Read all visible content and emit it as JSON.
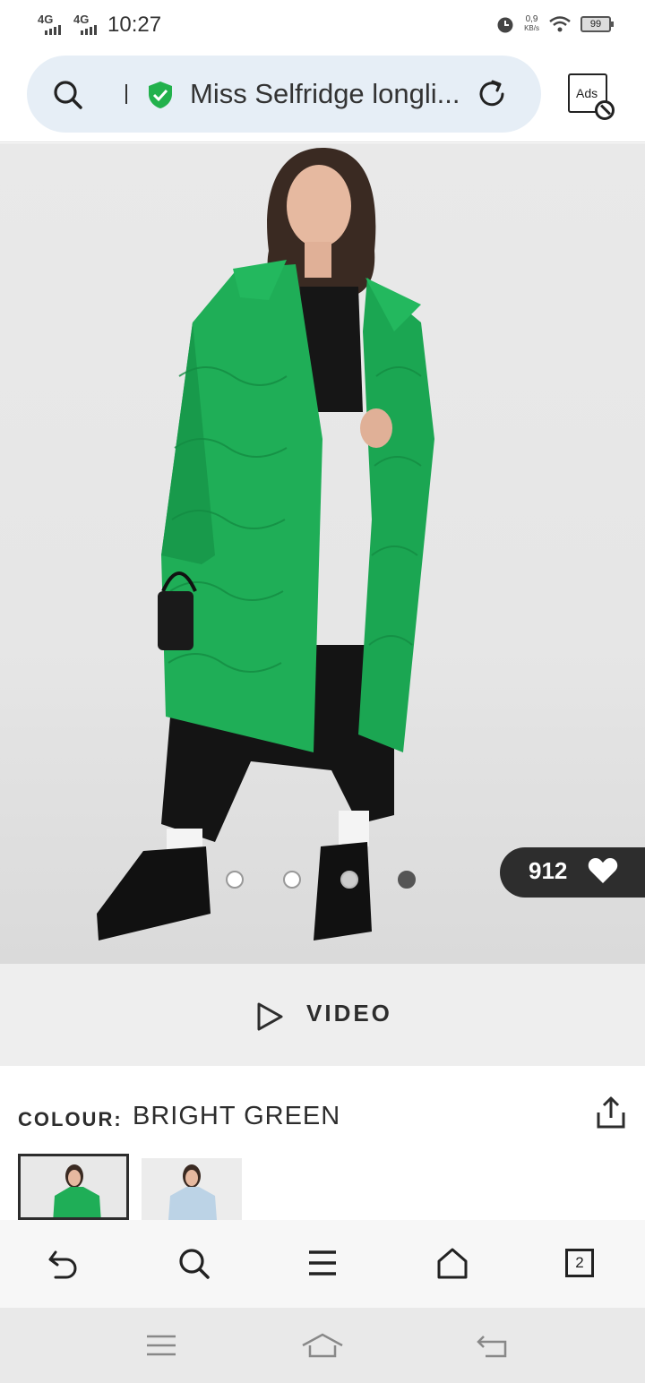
{
  "status_bar": {
    "network_1": "4G",
    "network_2": "4G",
    "time": "10:27",
    "speed_value": "0,9",
    "speed_unit": "KB/s",
    "battery": "99"
  },
  "address_bar": {
    "url_text": "Miss Selfridge longli...",
    "ads_label": "Ads"
  },
  "product_image": {
    "likes_count": "912",
    "carousel_total": 4,
    "carousel_active_index": 3,
    "coat_color": "#1fae57"
  },
  "video": {
    "label": "VIDEO"
  },
  "colour": {
    "key": "COLOUR:",
    "value": "BRIGHT GREEN"
  },
  "browser_bar": {
    "tab_count": "2"
  }
}
